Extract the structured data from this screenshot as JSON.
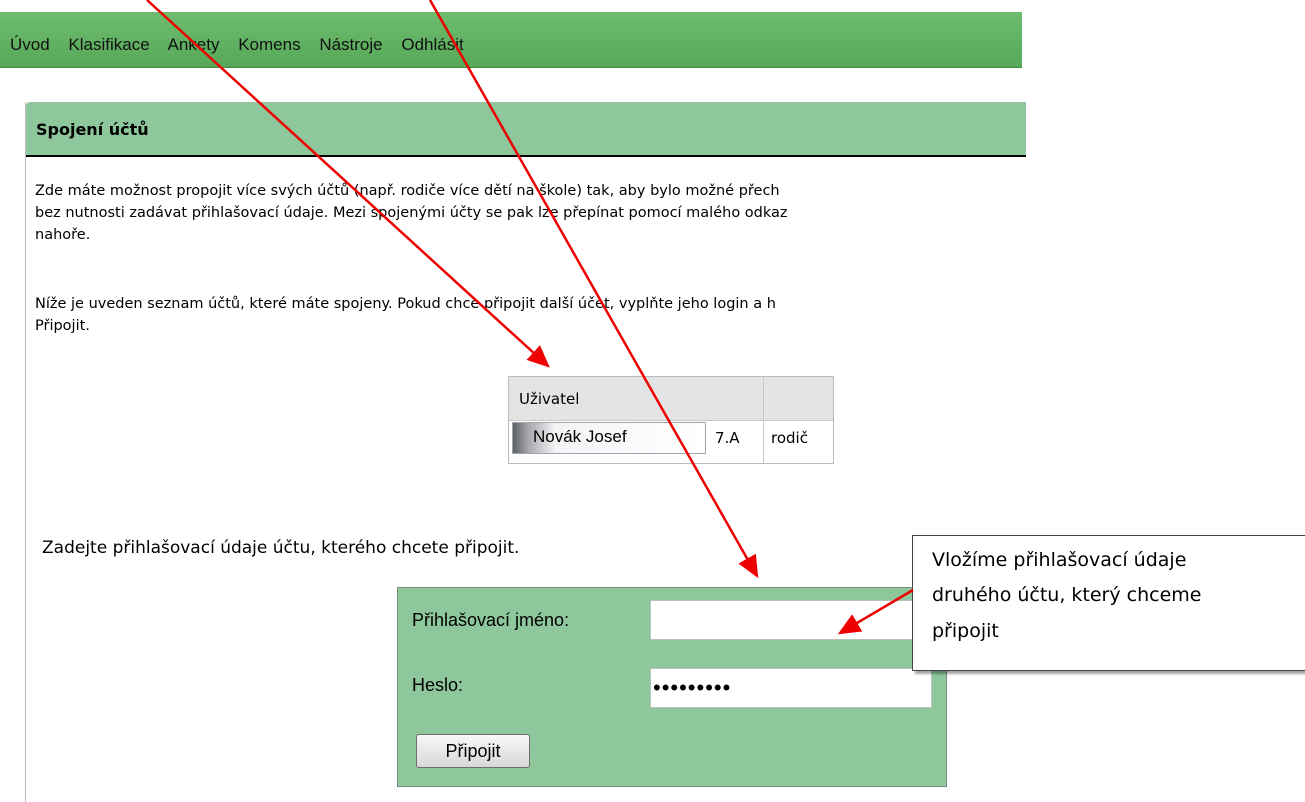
{
  "nav": {
    "items": [
      "Úvod",
      "Klasifikace",
      "Ankety",
      "Komens",
      "Nástroje",
      "Odhlásit"
    ]
  },
  "panel": {
    "title": "Spojení účtů",
    "desc_lines": [
      "Zde máte možnost propojit více svých účtů (např. rodiče více dětí na škole) tak, aby bylo možné přech",
      "bez nutnosti zadávat přihlašovací údaje. Mezi spojenými účty se pak lze přepínat pomocí malého odkaz",
      "nahoře.",
      "Níže je uveden seznam účtů, které máte spojeny. Pokud chce připojit další účet, vyplňte jeho login a h",
      "Připojit."
    ]
  },
  "accounts": {
    "header": "Uživatel",
    "rows": [
      {
        "name": "Novák Josef",
        "class": "7.A",
        "role": "rodič"
      }
    ]
  },
  "form": {
    "prompt": "Zadejte přihlašovací údaje účtu, kterého chcete připojit.",
    "login_label": "Přihlašovací jméno:",
    "login_value": "",
    "password_label": "Heslo:",
    "password_value": "•••••••••",
    "submit_label": "Připojit"
  },
  "callout": {
    "lines": [
      "Vložíme přihlašovací údaje",
      "druhého účtu, který chceme",
      "připojit"
    ]
  },
  "colors": {
    "nav_green": "#5eae61",
    "panel_green": "#8fc79c",
    "arrow_red": "#ee0000"
  }
}
